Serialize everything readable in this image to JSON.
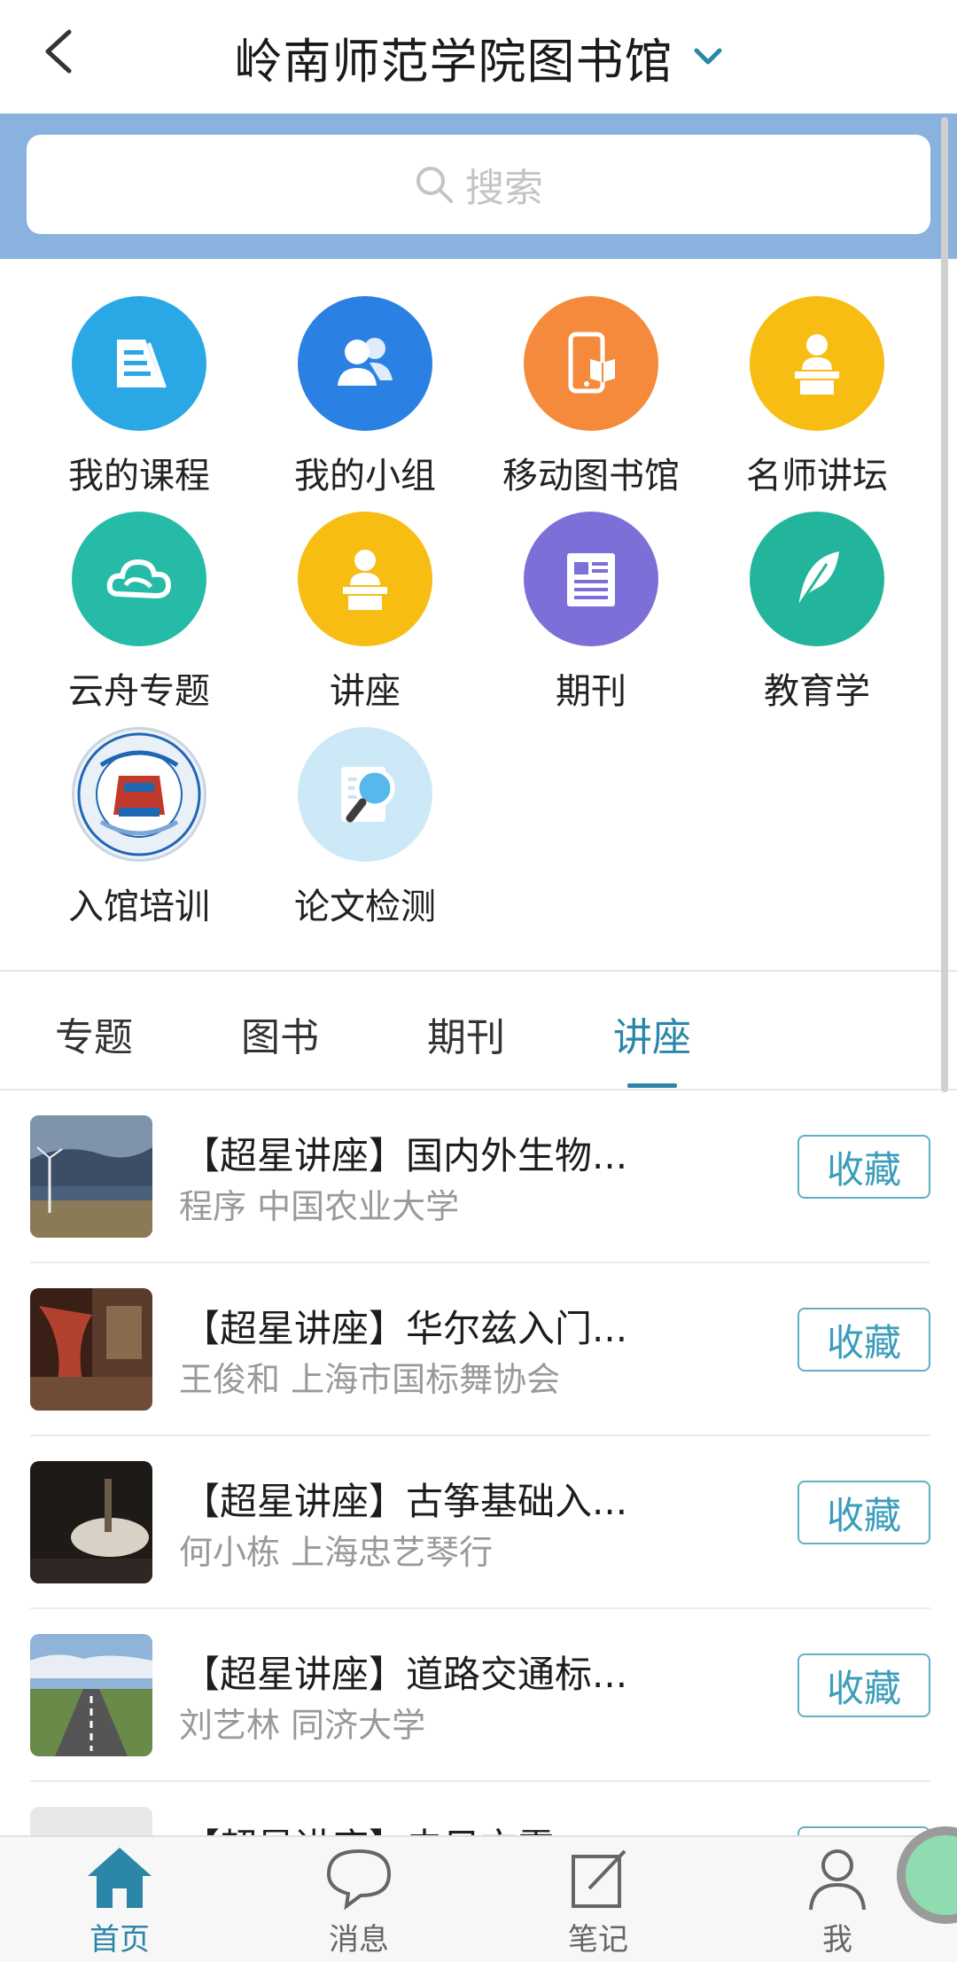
{
  "header": {
    "back_label": "返回",
    "title": "岭南师范学院图书馆"
  },
  "search": {
    "placeholder": "搜索"
  },
  "grid": [
    {
      "label": "我的课程",
      "icon": "book-icon",
      "color": "#2aa8e6"
    },
    {
      "label": "我的小组",
      "icon": "group-icon",
      "color": "#2b80e3"
    },
    {
      "label": "移动图书馆",
      "icon": "mobile-library-icon",
      "color": "#f58a3c"
    },
    {
      "label": "名师讲坛",
      "icon": "lecturer-icon",
      "color": "#f7bd13"
    },
    {
      "label": "云舟专题",
      "icon": "cloud-icon",
      "color": "#25bba7"
    },
    {
      "label": "讲座",
      "icon": "lecturer-icon",
      "color": "#f7bd13"
    },
    {
      "label": "期刊",
      "icon": "journal-icon",
      "color": "#7c6fd8"
    },
    {
      "label": "教育学",
      "icon": "feather-icon",
      "color": "#22b59b"
    },
    {
      "label": "入馆培训",
      "icon": "school-emblem-icon",
      "color": "#1f66b3"
    },
    {
      "label": "论文检测",
      "icon": "magnifier-doc-icon",
      "color": "#57b8ec"
    }
  ],
  "tabs": [
    {
      "label": "专题",
      "active": false
    },
    {
      "label": "图书",
      "active": false
    },
    {
      "label": "期刊",
      "active": false
    },
    {
      "label": "讲座",
      "active": true
    }
  ],
  "lectures": [
    {
      "title": "【超星讲座】国内外生物...",
      "subtitle": "程序 中国农业大学",
      "button": "收藏"
    },
    {
      "title": "【超星讲座】华尔兹入门...",
      "subtitle": "王俊和 上海市国标舞协会",
      "button": "收藏"
    },
    {
      "title": "【超星讲座】古筝基础入...",
      "subtitle": "何小栋 上海忠艺琴行",
      "button": "收藏"
    },
    {
      "title": "【超星讲座】道路交通标...",
      "subtitle": "刘艺林 同济大学",
      "button": "收藏"
    },
    {
      "title": "【超星讲座】去目文震...",
      "subtitle": "",
      "button": "收藏"
    }
  ],
  "nav": [
    {
      "label": "首页",
      "icon": "home-icon",
      "active": true
    },
    {
      "label": "消息",
      "icon": "message-icon",
      "active": false
    },
    {
      "label": "笔记",
      "icon": "note-icon",
      "active": false
    },
    {
      "label": "我",
      "icon": "user-icon",
      "active": false
    }
  ],
  "colors": {
    "accent": "#2b86a8",
    "search_band": "#8ab2df"
  }
}
